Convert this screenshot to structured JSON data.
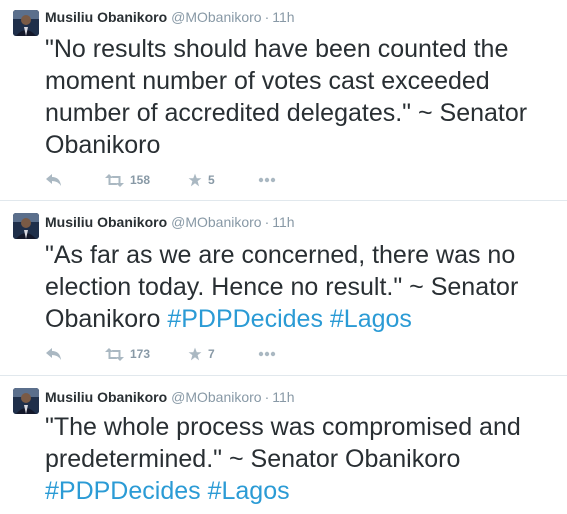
{
  "colors": {
    "text": "#292f33",
    "muted": "#8899a6",
    "icon": "#aab8c2",
    "hashtag": "#2b9bd5",
    "divider": "#e1e8ed"
  },
  "tweets": [
    {
      "fullname": "Musiliu Obanikoro",
      "screen_name": "@MObanikoro",
      "separator": "·",
      "time": "11h",
      "text": "\"No results should have been counted the moment number of votes cast exceeded number of accredited delegates.\" ~ Senator Obanikoro",
      "hashtags": [],
      "retweets": "158",
      "favorites": "5",
      "icons": {
        "reply": "reply-icon",
        "retweet": "retweet-icon",
        "favorite": "star-icon",
        "more": "more-icon"
      }
    },
    {
      "fullname": "Musiliu Obanikoro",
      "screen_name": "@MObanikoro",
      "separator": "·",
      "time": "11h",
      "text": "\"As far as we are concerned, there was no election today. Hence no result.\" ~ Senator Obanikoro",
      "hashtags": [
        "#PDPDecides",
        "#Lagos"
      ],
      "retweets": "173",
      "favorites": "7",
      "icons": {
        "reply": "reply-icon",
        "retweet": "retweet-icon",
        "favorite": "star-icon",
        "more": "more-icon"
      }
    },
    {
      "fullname": "Musiliu Obanikoro",
      "screen_name": "@MObanikoro",
      "separator": "·",
      "time": "11h",
      "text": "\"The whole process was compromised and predetermined.\" ~ Senator Obanikoro",
      "hashtags": [
        "#PDPDecides",
        "#Lagos"
      ]
    }
  ]
}
